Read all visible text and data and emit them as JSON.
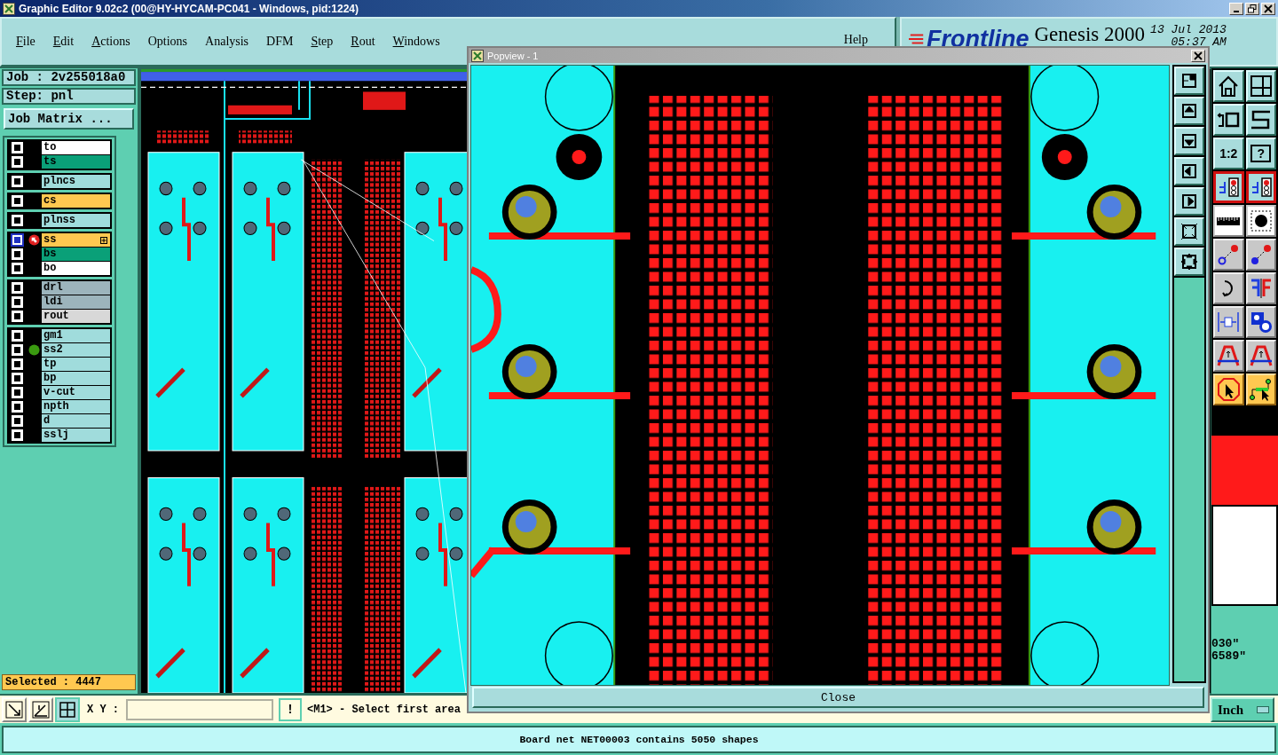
{
  "window": {
    "title": "Graphic Editor 9.02c2 (00@HY-HYCAM-PC041 - Windows, pid:1224)"
  },
  "menu": [
    {
      "label": "File",
      "mnemonic": true
    },
    {
      "label": "Edit",
      "mnemonic": true
    },
    {
      "label": "Actions",
      "mnemonic": true
    },
    {
      "label": "Options",
      "mnemonic": false
    },
    {
      "label": "Analysis",
      "mnemonic": false
    },
    {
      "label": "DFM",
      "mnemonic": false
    },
    {
      "label": "Step",
      "mnemonic": true
    },
    {
      "label": "Rout",
      "mnemonic": true
    },
    {
      "label": "Windows",
      "mnemonic": true
    }
  ],
  "help_menu": "Help",
  "brand": {
    "logo": "Frontline",
    "product": "Genesis 2000",
    "date": "13 Jul 2013",
    "time": "05:37 AM"
  },
  "job": {
    "job": "Job : 2v255018a0",
    "step": "Step: pnl",
    "matrix_button": "Job Matrix ..."
  },
  "layer_groups": [
    [
      {
        "name": "to",
        "color": "#ffffff",
        "selected": false,
        "work": false,
        "marked": false
      },
      {
        "name": "ts",
        "color": "#0aa078",
        "selected": false,
        "work": false,
        "marked": false
      }
    ],
    [
      {
        "name": "plncs",
        "color": "#a0dcdc",
        "selected": false,
        "work": false,
        "marked": false
      }
    ],
    [
      {
        "name": "cs",
        "color": "#ffc850",
        "selected": false,
        "work": false,
        "marked": false
      }
    ],
    [
      {
        "name": "plnss",
        "color": "#a0dcdc",
        "selected": false,
        "work": false,
        "marked": false
      }
    ],
    [
      {
        "name": "ss",
        "color": "#ffc850",
        "selected": true,
        "work": true,
        "marked": false
      },
      {
        "name": "bs",
        "color": "#0aa078",
        "selected": false,
        "work": false,
        "marked": false
      },
      {
        "name": "bo",
        "color": "#ffffff",
        "selected": false,
        "work": false,
        "marked": false
      }
    ],
    [
      {
        "name": "drl",
        "color": "#9cb4bc",
        "selected": false,
        "work": false,
        "marked": false
      },
      {
        "name": "ldi",
        "color": "#9cb4bc",
        "selected": false,
        "work": false,
        "marked": false
      },
      {
        "name": "rout",
        "color": "#d8d8d8",
        "selected": false,
        "work": false,
        "marked": false
      }
    ],
    [
      {
        "name": "gm1",
        "color": "#a0dcdc",
        "selected": false,
        "work": false,
        "marked": false
      },
      {
        "name": "ss2",
        "color": "#a0dcdc",
        "selected": false,
        "work": false,
        "marked": true
      },
      {
        "name": "tp",
        "color": "#a0dcdc",
        "selected": false,
        "work": false,
        "marked": false
      },
      {
        "name": "bp",
        "color": "#a0dcdc",
        "selected": false,
        "work": false,
        "marked": false
      },
      {
        "name": "v-cut",
        "color": "#a0dcdc",
        "selected": false,
        "work": false,
        "marked": false
      },
      {
        "name": "npth",
        "color": "#a0dcdc",
        "selected": false,
        "work": false,
        "marked": false
      },
      {
        "name": "d",
        "color": "#a0dcdc",
        "selected": false,
        "work": false,
        "marked": false
      },
      {
        "name": "sslj",
        "color": "#a0dcdc",
        "selected": false,
        "work": false,
        "marked": false
      }
    ]
  ],
  "selected_count": "Selected : 4447",
  "right_tools": [
    {
      "kind": "home",
      "selected": false,
      "active": false
    },
    {
      "kind": "grid",
      "selected": false,
      "active": false
    },
    {
      "kind": "undo",
      "selected": false,
      "active": false
    },
    {
      "kind": "route",
      "selected": false,
      "active": false
    },
    {
      "kind": "label",
      "label": "1:2",
      "selected": false,
      "active": false
    },
    {
      "kind": "boxlabel",
      "label": "?",
      "selected": false,
      "active": false
    },
    {
      "kind": "net",
      "selected": true,
      "active": false
    },
    {
      "kind": "net",
      "selected": true,
      "active": false
    },
    {
      "kind": "ruler",
      "selected": false,
      "active": false
    },
    {
      "kind": "pad",
      "selected": false,
      "active": false
    },
    {
      "kind": "link-open",
      "selected": false,
      "active": false
    },
    {
      "kind": "link-filled",
      "selected": false,
      "active": false
    },
    {
      "kind": "arc",
      "selected": false,
      "active": false
    },
    {
      "kind": "mirror",
      "selected": false,
      "active": false
    },
    {
      "kind": "measure",
      "selected": false,
      "active": false
    },
    {
      "kind": "shapes",
      "selected": false,
      "active": false
    },
    {
      "kind": "arch",
      "selected": false,
      "active": false
    },
    {
      "kind": "arch",
      "selected": false,
      "active": false
    },
    {
      "kind": "pointer",
      "selected": false,
      "active": true
    },
    {
      "kind": "net-select",
      "selected": false,
      "active": true
    }
  ],
  "readout": [
    "030\"",
    "6589\""
  ],
  "units": "Inch",
  "bottom": {
    "xy_label": "X Y :",
    "stop_button": "!",
    "prompt": "<M1> - Select first area"
  },
  "popup": {
    "title": "Popview - 1",
    "close_button": "Close"
  },
  "status": "Board net NET00003 contains 5050 shapes"
}
